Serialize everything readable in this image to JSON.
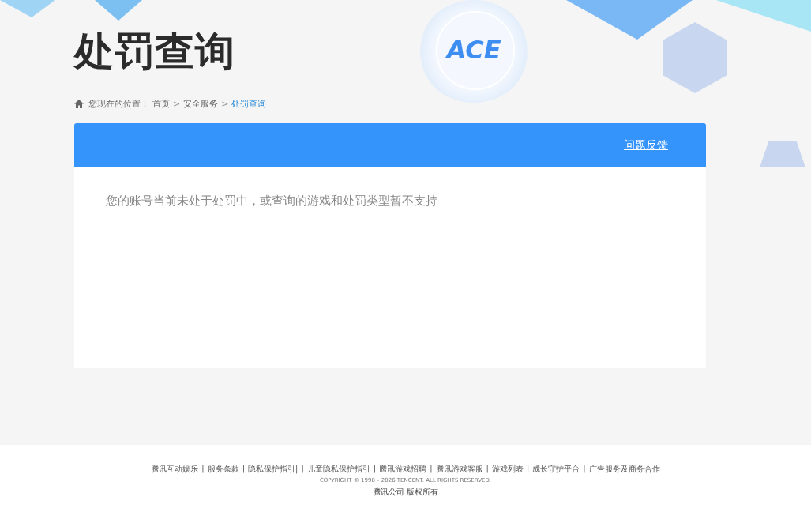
{
  "header": {
    "title": "处罚查询",
    "logo_text": "ACE"
  },
  "breadcrumb": {
    "label": "您现在的位置：",
    "items": [
      {
        "text": "首页",
        "current": false
      },
      {
        "text": "安全服务",
        "current": false
      },
      {
        "text": "处罚查询",
        "current": true
      }
    ],
    "separator": ">"
  },
  "panel": {
    "feedback_link": "问题反馈",
    "message": "您的账号当前未处于处罚中，或查询的游戏和处罚类型暂不支持"
  },
  "footer": {
    "separator": "|",
    "links": [
      "腾讯互动娱乐",
      "服务条款",
      "隐私保护指引|",
      "儿童隐私保护指引",
      "腾讯游戏招聘",
      "腾讯游戏客服",
      "游戏列表",
      "成长守护平台",
      "广告服务及商务合作"
    ],
    "copyright": "COPYRIGHT © 1998 – 2026 TENCENT. ALL RIGHTS RESERVED.",
    "rights": "腾讯公司 版权所有"
  }
}
